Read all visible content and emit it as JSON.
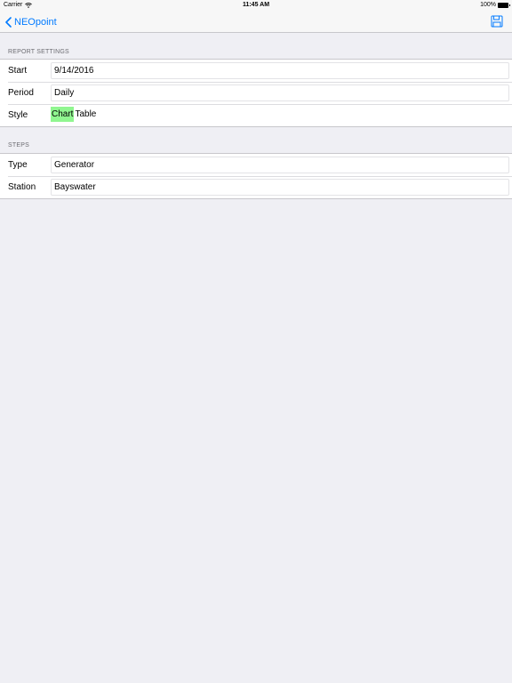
{
  "status": {
    "carrier": "Carrier",
    "time": "11:45 AM",
    "battery": "100%"
  },
  "nav": {
    "back_label": "NEOpoint",
    "save_icon": "save-icon"
  },
  "report_settings": {
    "header": "REPORT SETTINGS",
    "start": {
      "label": "Start",
      "value": "9/14/2016"
    },
    "period": {
      "label": "Period",
      "value": "Daily"
    },
    "style": {
      "label": "Style",
      "options": [
        "Chart",
        "Table"
      ],
      "selected": "Chart"
    }
  },
  "steps": {
    "header": "STEPS",
    "type": {
      "label": "Type",
      "value": "Generator"
    },
    "station": {
      "label": "Station",
      "value": "Bayswater"
    }
  },
  "colors": {
    "accent": "#007aff",
    "selected_highlight": "#90f690",
    "background": "#efeff4"
  }
}
